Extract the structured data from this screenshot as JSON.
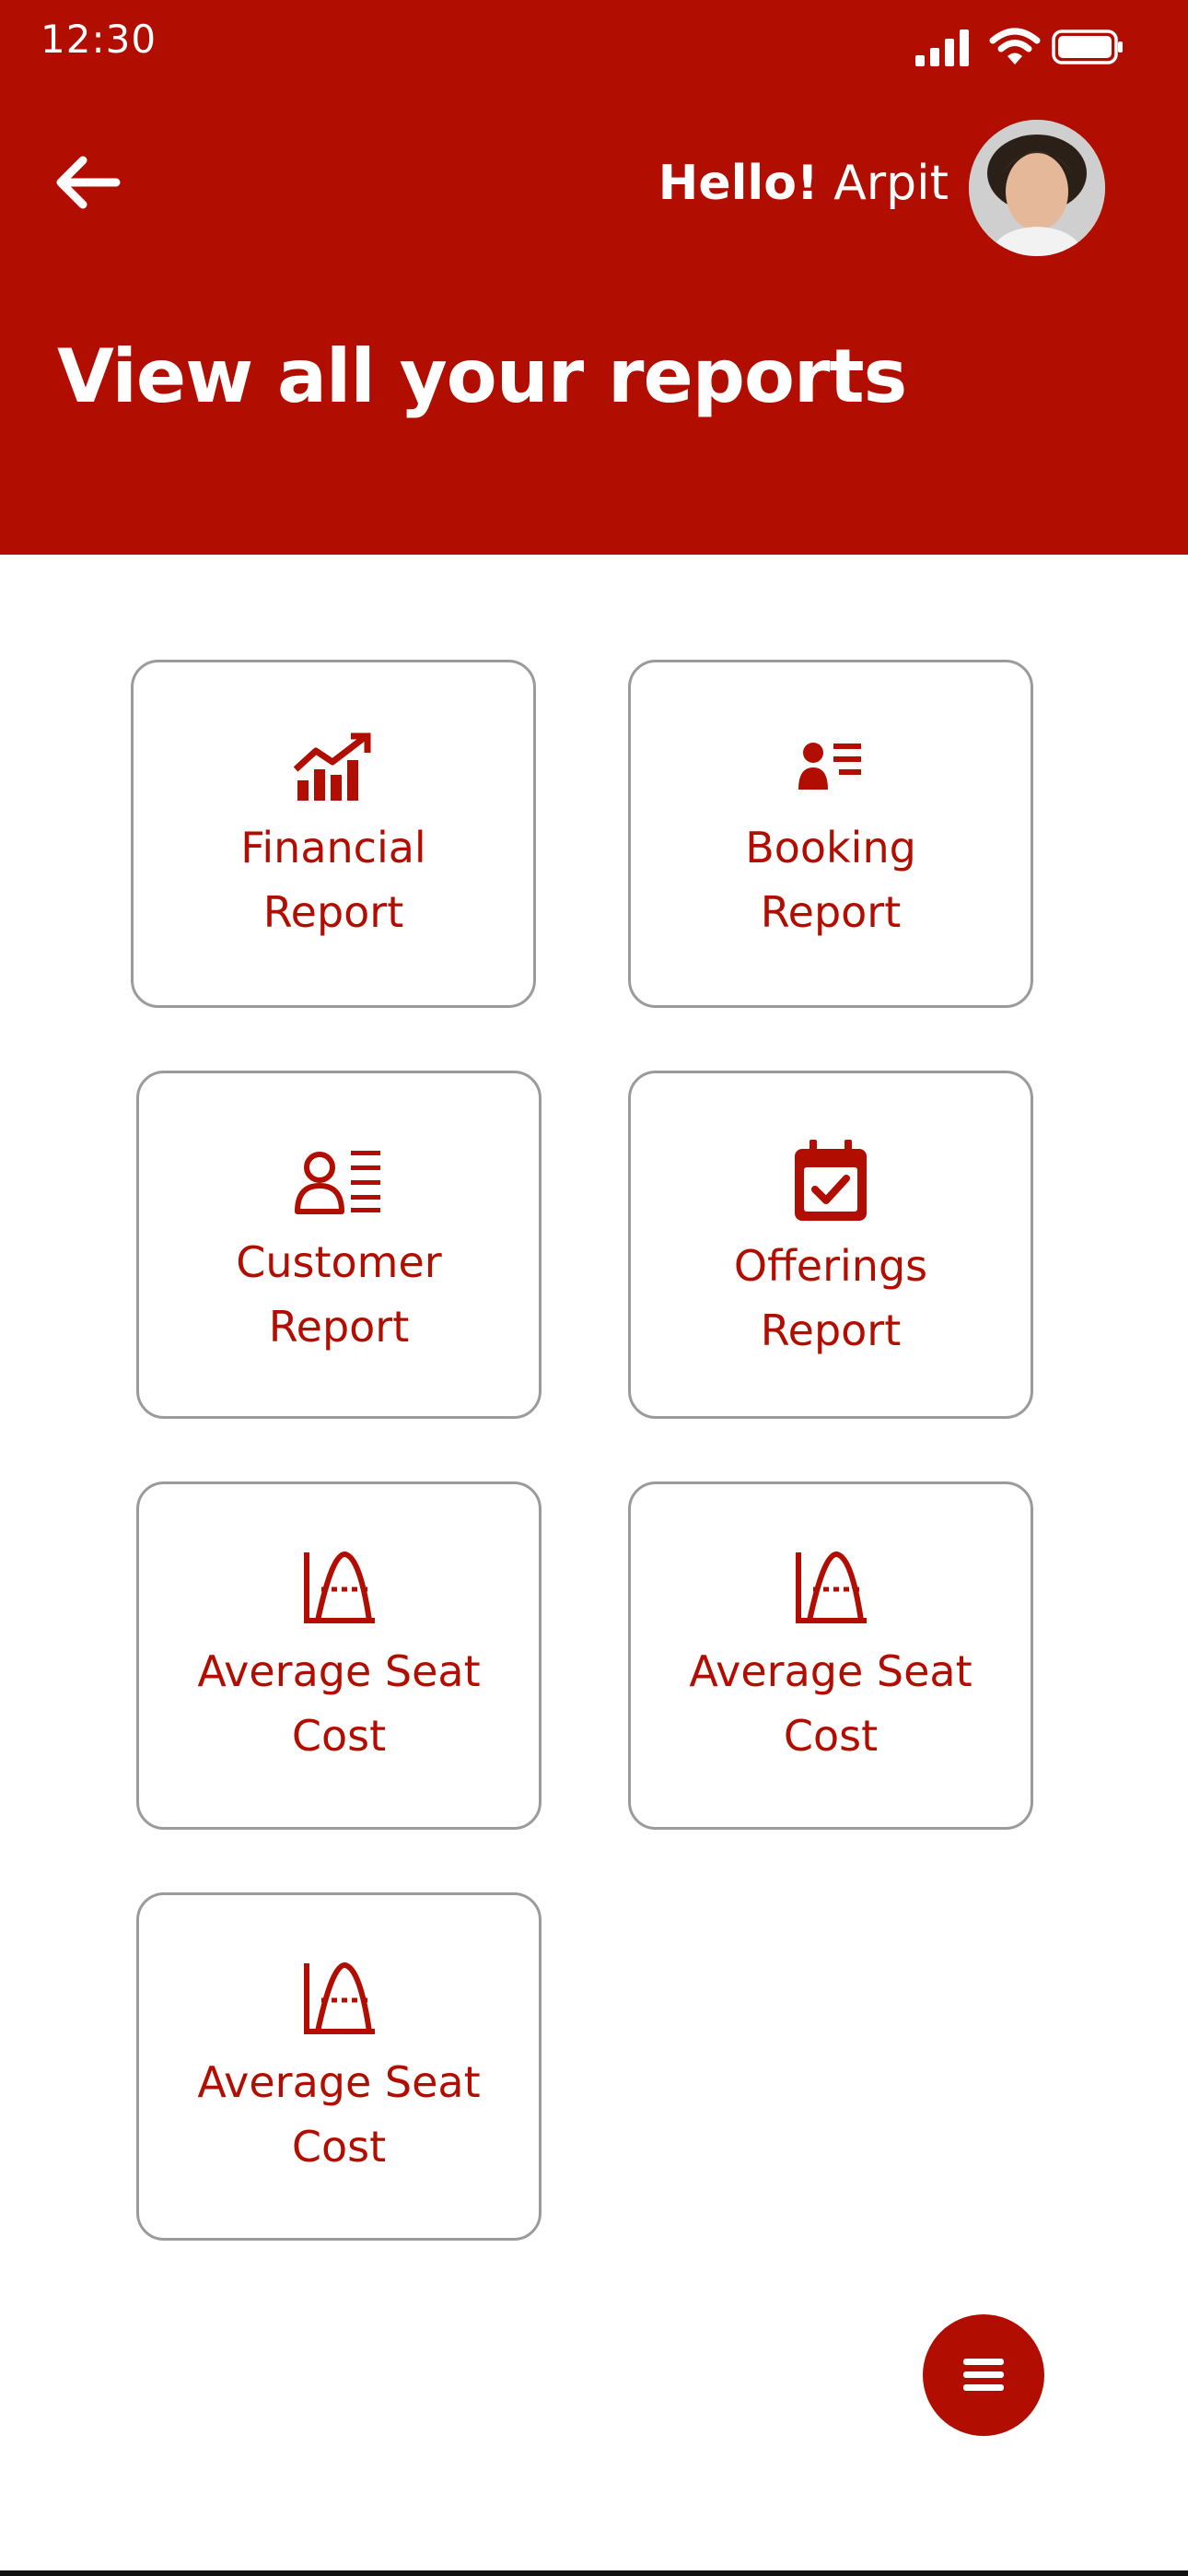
{
  "status_bar": {
    "time": "12:30"
  },
  "header": {
    "greeting_bold": "Hello!",
    "user_name": "Arpit",
    "title": "View all your reports"
  },
  "reports": [
    {
      "line1": "Financial",
      "line2": "Report",
      "icon": "chart-growth-icon"
    },
    {
      "line1": "Booking",
      "line2": "Report",
      "icon": "user-list-icon"
    },
    {
      "line1": "Customer",
      "line2": "Report",
      "icon": "user-list-outline-icon"
    },
    {
      "line1": "Offerings",
      "line2": "Report",
      "icon": "calendar-check-icon"
    },
    {
      "line1": "Average Seat",
      "line2": "Cost",
      "icon": "bell-curve-icon"
    },
    {
      "line1": "Average Seat",
      "line2": "Cost",
      "icon": "bell-curve-icon"
    },
    {
      "line1": "Average Seat",
      "line2": "Cost",
      "icon": "bell-curve-icon"
    }
  ],
  "colors": {
    "brand": "#b10e01",
    "card_border": "#9b9b9b",
    "background": "#ffffff"
  }
}
